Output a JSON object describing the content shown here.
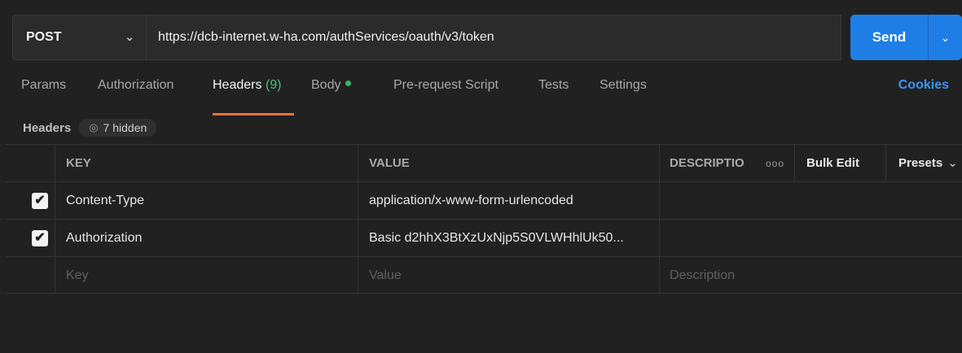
{
  "request": {
    "method": "POST",
    "url": "https://dcb-internet.w-ha.com/authServices/oauth/v3/token",
    "send_label": "Send"
  },
  "tabs": [
    {
      "label": "Params"
    },
    {
      "label": "Authorization"
    },
    {
      "label": "Headers",
      "count": "(9)",
      "active": true
    },
    {
      "label": "Body",
      "has_dot": true
    },
    {
      "label": "Pre-request Script"
    },
    {
      "label": "Tests"
    },
    {
      "label": "Settings"
    }
  ],
  "cookies_label": "Cookies",
  "headers_section": {
    "title": "Headers",
    "hidden_label": "7 hidden"
  },
  "table": {
    "columns": {
      "key": "KEY",
      "value": "VALUE",
      "description": "DESCRIPTIO"
    },
    "more_icon": "ooo",
    "bulk_edit": "Bulk Edit",
    "presets": "Presets",
    "rows": [
      {
        "checked": true,
        "key": "Content-Type",
        "value": "application/x-www-form-urlencoded",
        "description": ""
      },
      {
        "checked": true,
        "key": "Authorization",
        "value": "Basic d2hhX3BtXzUxNjp5S0VLWHhlUk50...",
        "description": ""
      }
    ],
    "placeholders": {
      "key": "Key",
      "value": "Value",
      "description": "Description"
    }
  },
  "colors": {
    "send": "#1e7ee6",
    "active_tab_underline": "#ff6c37",
    "cookies": "#3d94f5",
    "status_dot": "#32b868"
  }
}
